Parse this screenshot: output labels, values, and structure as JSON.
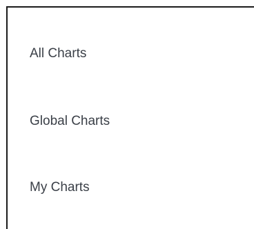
{
  "menu": {
    "items": [
      {
        "label": "All Charts"
      },
      {
        "label": "Global Charts"
      },
      {
        "label": "My Charts"
      }
    ]
  },
  "colors": {
    "background": "#ffffff",
    "text": "#3a3f47",
    "border": "#1a1a1a"
  }
}
